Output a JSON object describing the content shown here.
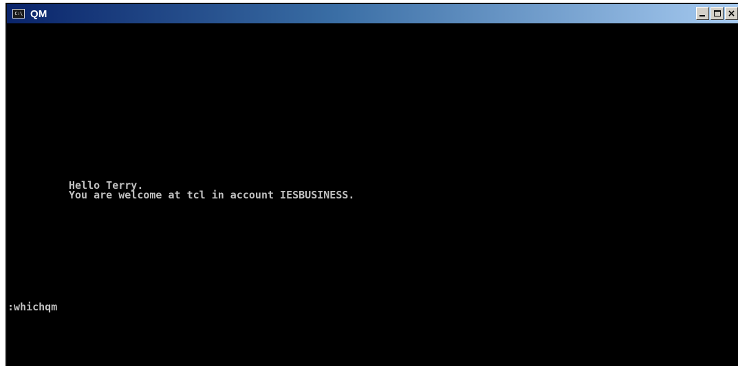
{
  "window": {
    "title": "QM",
    "icon_label": "C:\\",
    "controls": {
      "minimize_icon": "minimize-icon",
      "maximize_icon": "maximize-icon",
      "close_icon": "close-icon",
      "close_glyph": "×"
    }
  },
  "console": {
    "lines": [
      "Hello Terry.",
      "You are welcome at tcl in account IESBUSINESS."
    ],
    "prompt_line": ":whichqm",
    "text_color": "#c0c0c0",
    "background_color": "#000000"
  }
}
